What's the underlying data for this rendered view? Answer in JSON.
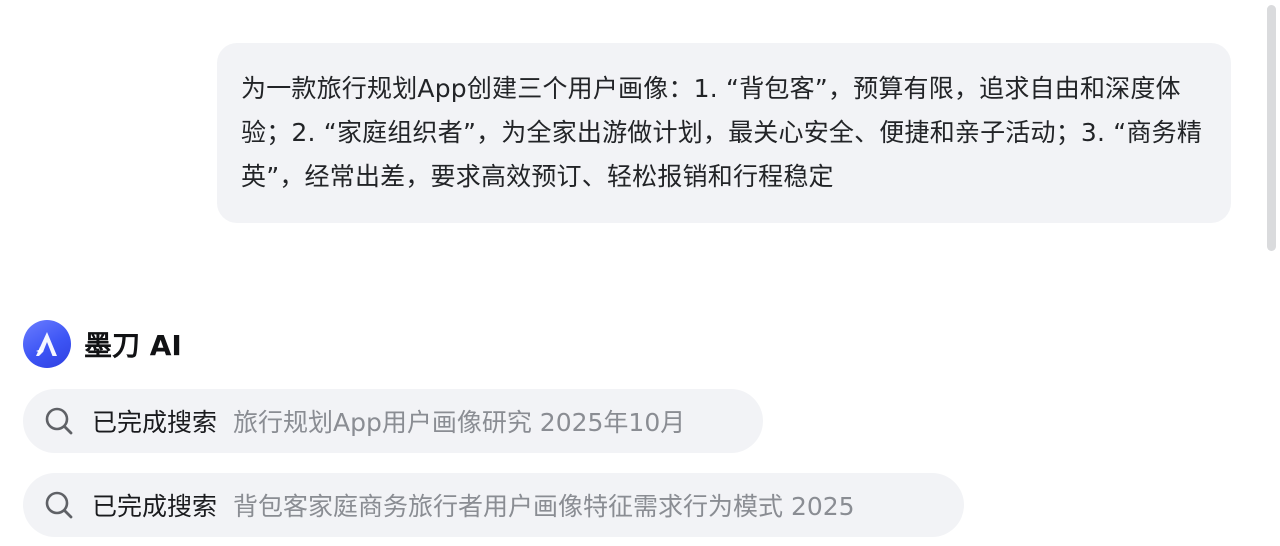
{
  "user_message": {
    "text": "为一款旅行规划App创建三个用户画像：1. “背包客”，预算有限，追求自由和深度体验；2. “家庭组织者”，为全家出游做计划，最关心安全、便捷和亲子活动；3. “商务精英”，经常出差，要求高效预订、轻松报销和行程稳定"
  },
  "assistant": {
    "name": "墨刀 AI",
    "avatar_icon": "modao-ai-logo-icon"
  },
  "searches": [
    {
      "status": "已完成搜索",
      "query": "旅行规划App用户画像研究 2025年10月",
      "icon": "search-icon"
    },
    {
      "status": "已完成搜索",
      "query": "背包客家庭商务旅行者用户画像特征需求行为模式 2025",
      "icon": "search-icon"
    }
  ],
  "colors": {
    "bubble_bg": "#f2f3f6",
    "avatar_accent": "#3d55f5",
    "muted_text": "#8a8d93"
  }
}
